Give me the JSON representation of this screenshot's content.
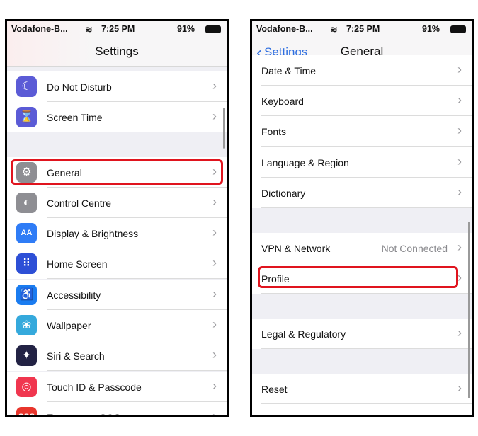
{
  "status": {
    "carrier": "Vodafone-B...",
    "time": "7:25 PM",
    "battery": "91%"
  },
  "left": {
    "title": "Settings",
    "items": [
      {
        "label": "Do Not Disturb",
        "icon": "moon-icon",
        "color": "#5b5bd6",
        "glyph": "☾"
      },
      {
        "label": "Screen Time",
        "icon": "hourglass-icon",
        "color": "#5b5bd6",
        "glyph": "⌛"
      },
      {
        "label": "General",
        "icon": "gear-icon",
        "color": "#8e8e93",
        "glyph": "⚙"
      },
      {
        "label": "Control Centre",
        "icon": "toggles-icon",
        "color": "#8e8e93",
        "glyph": "◐"
      },
      {
        "label": "Display & Brightness",
        "icon": "text-size-icon",
        "color": "#2f7cf6",
        "glyph": "AA"
      },
      {
        "label": "Home Screen",
        "icon": "grid-icon",
        "color": "#2d4fd6",
        "glyph": "⠿"
      },
      {
        "label": "Accessibility",
        "icon": "accessibility-icon",
        "color": "#1a7cf0",
        "glyph": "♿"
      },
      {
        "label": "Wallpaper",
        "icon": "flower-icon",
        "color": "#35a9dc",
        "glyph": "❀"
      },
      {
        "label": "Siri & Search",
        "icon": "siri-icon",
        "color": "#222244",
        "glyph": "✦"
      },
      {
        "label": "Touch ID & Passcode",
        "icon": "fingerprint-icon",
        "color": "#f0364f",
        "glyph": "◎"
      },
      {
        "label": "Emergency SOS",
        "icon": "sos-icon",
        "color": "#e8352c",
        "glyph": "SOS"
      }
    ]
  },
  "right": {
    "back": "Settings",
    "title": "General",
    "items": [
      {
        "label": "Date & Time"
      },
      {
        "label": "Keyboard"
      },
      {
        "label": "Fonts"
      },
      {
        "label": "Language & Region"
      },
      {
        "label": "Dictionary"
      },
      {
        "label": "VPN & Network",
        "value": "Not Connected"
      },
      {
        "label": "Profile"
      },
      {
        "label": "Legal & Regulatory"
      },
      {
        "label": "Reset"
      }
    ]
  },
  "highlight_color": "#e0141e"
}
